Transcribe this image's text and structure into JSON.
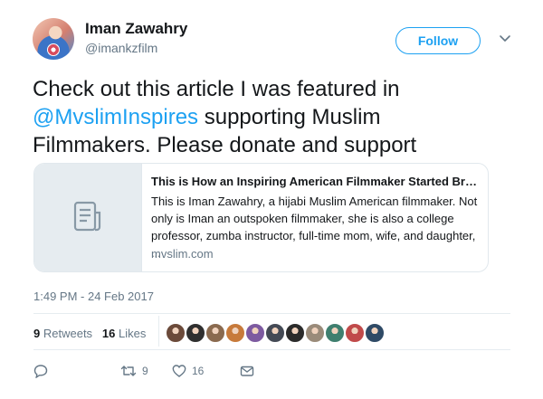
{
  "user": {
    "name": "Iman Zawahry",
    "handle": "@imankzfilm"
  },
  "follow_label": "Follow",
  "tweet": {
    "mention": "@MvslimInspires",
    "line1": "Check out this article I was featured in",
    "rest": " supporting Muslim Filmmakers. Please donate and support"
  },
  "card": {
    "title": "This is How an Inspiring American Filmmaker Started Break...",
    "description": "This is Iman Zawahry, a hijabi Muslim American filmmaker. Not only is Iman an outspoken filmmaker, she is also a college professor, zumba instructor, full-time mom, wife, and daughter, ...",
    "domain": "mvslim.com"
  },
  "timestamp": "1:49 PM - 24 Feb 2017",
  "stats": {
    "retweets_count": "9",
    "retweets_label": "Retweets",
    "likes_count": "16",
    "likes_label": "Likes"
  },
  "liker_colors": [
    "#6b4a3a",
    "#2f2f2f",
    "#8a6a4f",
    "#c77a3b",
    "#7d5aa0",
    "#444a55",
    "#2b2b2b",
    "#9a8b7a",
    "#3f7f6f",
    "#c04a4a",
    "#2f4a66"
  ],
  "actions": {
    "retweet_count": "9",
    "like_count": "16"
  },
  "colors": {
    "accent": "#1da1f2",
    "secondary": "#657786"
  }
}
